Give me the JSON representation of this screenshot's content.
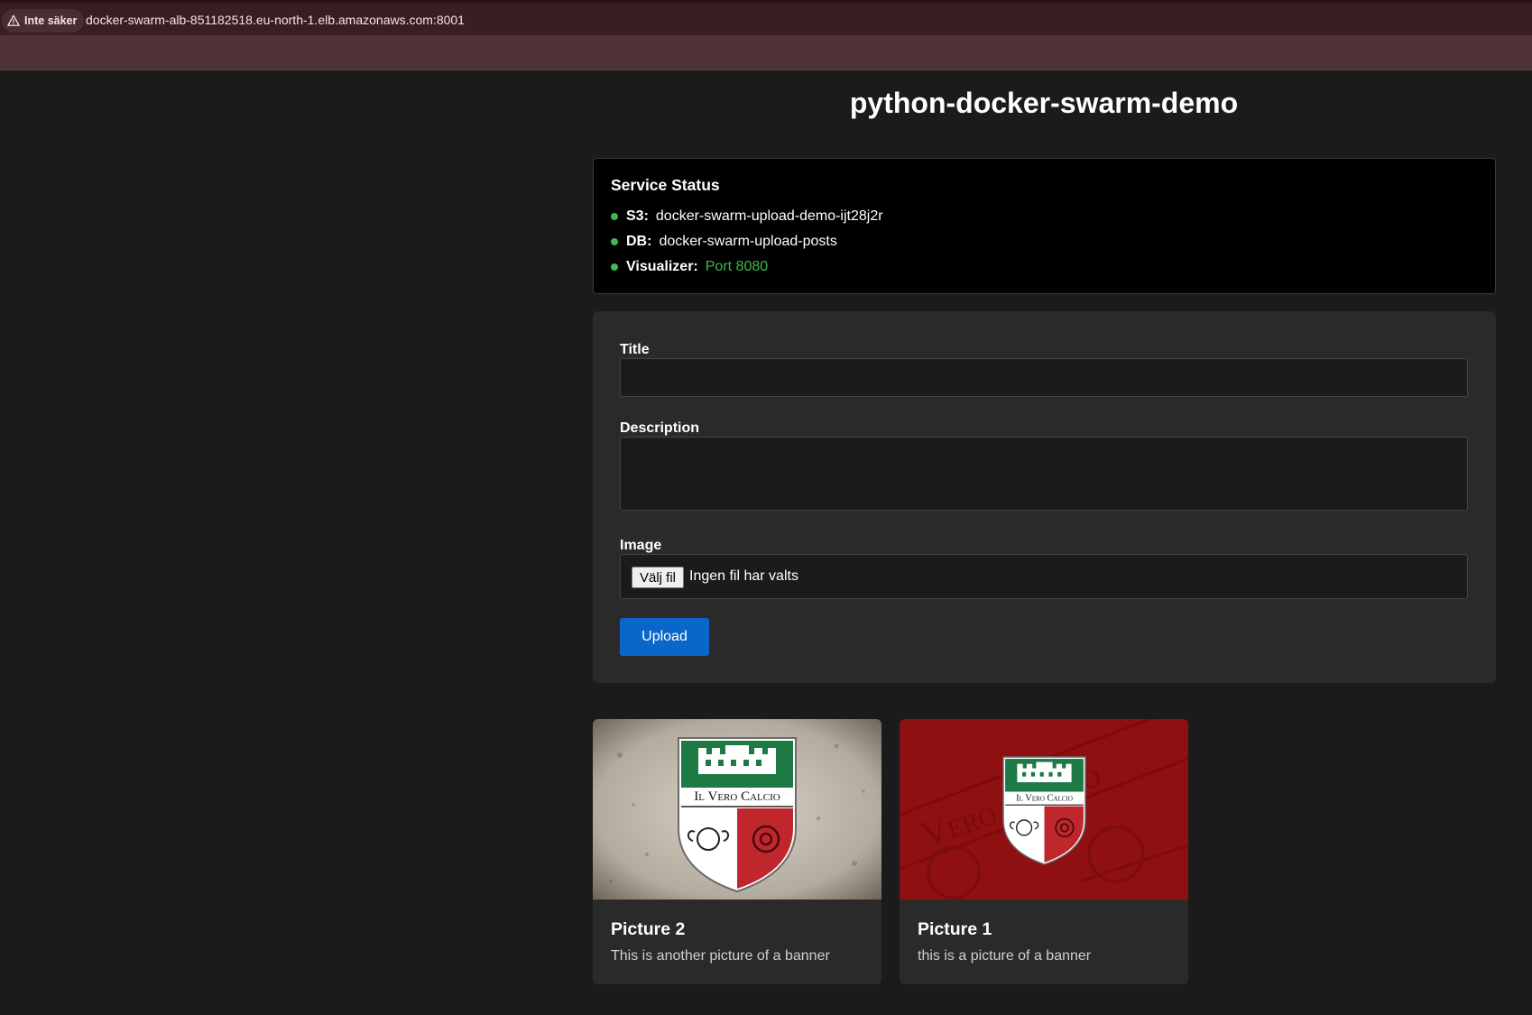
{
  "browser": {
    "security_label": "Inte säker",
    "url": "docker-swarm-alb-851182518.eu-north-1.elb.amazonaws.com:8001"
  },
  "page": {
    "title": "python-docker-swarm-demo"
  },
  "status": {
    "heading": "Service Status",
    "items": [
      {
        "label": "S3:",
        "value": "docker-swarm-upload-demo-ijt28j2r"
      },
      {
        "label": "DB:",
        "value": "docker-swarm-upload-posts"
      },
      {
        "label": "Visualizer:",
        "value": "Port 8080"
      }
    ]
  },
  "form": {
    "title_label": "Title",
    "title_value": "",
    "description_label": "Description",
    "description_value": "",
    "image_label": "Image",
    "file_button": "Välj fil",
    "file_status": "Ingen fil har valts",
    "upload_button": "Upload"
  },
  "posts": [
    {
      "title": "Picture 2",
      "description": "This is another picture of a banner",
      "crest_text": "Il Vero Calcio",
      "background": "stone"
    },
    {
      "title": "Picture 1",
      "description": "this is a picture of a banner",
      "crest_text": "Il Vero Calcio",
      "background": "red"
    }
  ],
  "colors": {
    "accent_blue": "#0a66c9",
    "status_green": "#3fb94d",
    "crest_green": "#1d7a44",
    "crest_red": "#c0272d"
  }
}
